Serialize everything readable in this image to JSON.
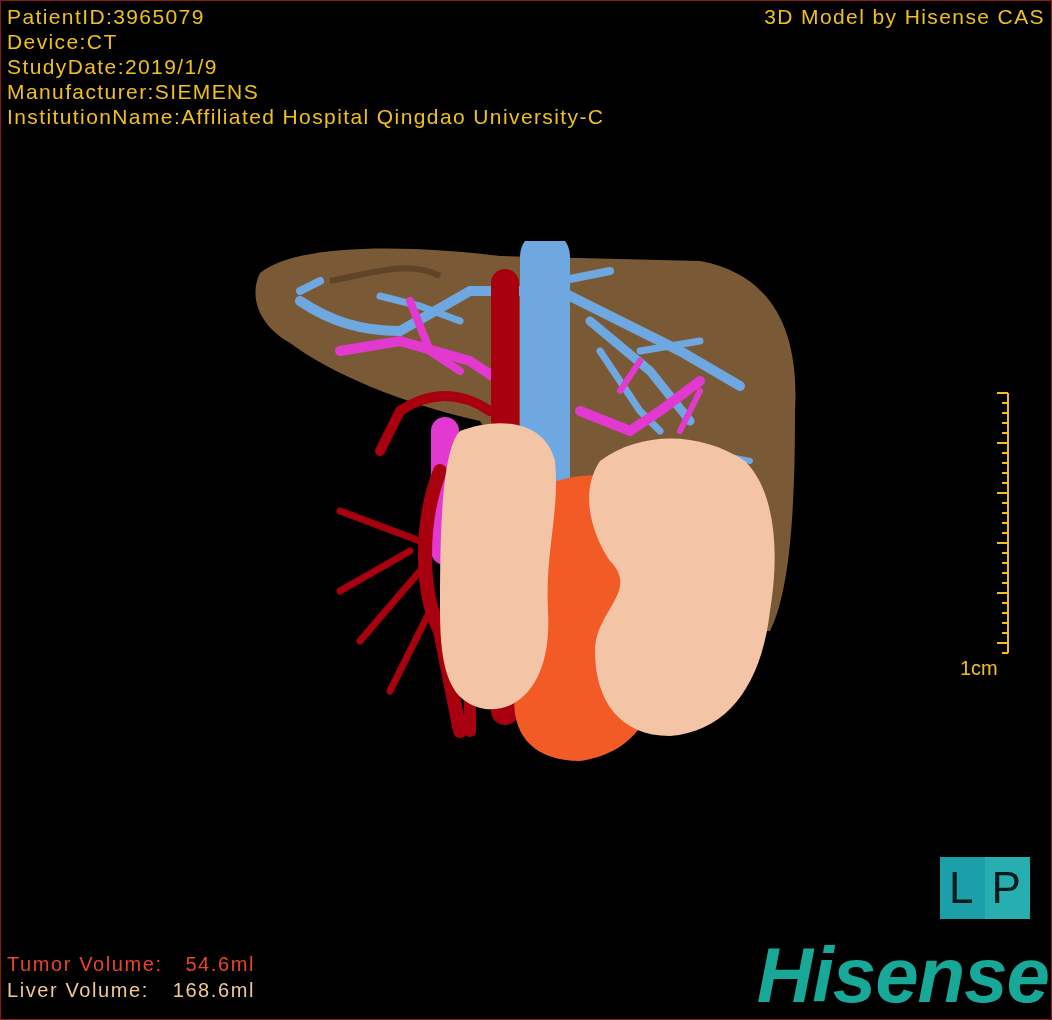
{
  "info_lines": [
    "PatientID:3965079",
    "Device:CT",
    "StudyDate:2019/1/9",
    "Manufacturer:SIEMENS",
    "InstitutionName:Affiliated Hospital Qingdao University-C"
  ],
  "caption": "3D Model by Hisense CAS",
  "scale_bar": {
    "label": "1cm"
  },
  "orientation_cube": [
    "L",
    "P"
  ],
  "volumes": [
    {
      "label": "Tumor Volume:",
      "value": "54.6ml",
      "color": "#e8452a"
    },
    {
      "label": "Liver Volume:",
      "value": "168.6ml",
      "color": "#f2c991"
    }
  ],
  "logo": "Hisense"
}
